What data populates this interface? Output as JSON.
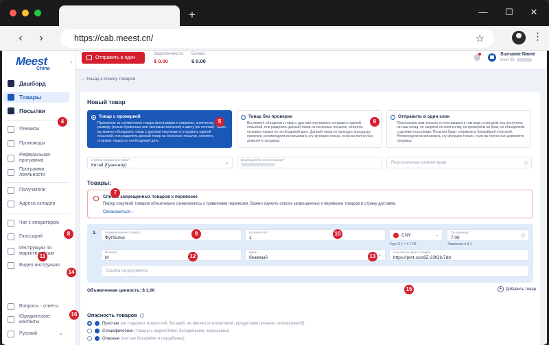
{
  "browser": {
    "url": "https://cab.meest.cn/",
    "new_tab_label": "+",
    "back_icon": "‹",
    "forward_icon": "›",
    "star_icon": "☆",
    "kebab_icon": "⋮",
    "minimize_icon": "—",
    "maximize_icon": "☐",
    "close_icon": "✕",
    "traffic_lights": [
      "#ff5f57",
      "#febc2e",
      "#28c840"
    ]
  },
  "brand": {
    "logo": "Meest",
    "sub": "China",
    "accent": "#1a57b7",
    "red": "#d6202f"
  },
  "sidebar": {
    "collapse_icon": "‹",
    "main": [
      {
        "label": "Дашборд",
        "icon": "dashboard-icon",
        "active": false
      },
      {
        "label": "Товары",
        "icon": "box-icon",
        "active": true
      },
      {
        "label": "Посылки",
        "icon": "parcel-icon",
        "active": false
      }
    ],
    "group1": [
      {
        "label": "Финансы",
        "icon": "finance-icon"
      },
      {
        "label": "Промокоды",
        "icon": "promo-icon"
      },
      {
        "label": "Реферальная программа",
        "icon": "referral-icon"
      },
      {
        "label": "Программа лояльности",
        "icon": "loyalty-icon"
      }
    ],
    "group2": [
      {
        "label": "Получатели",
        "icon": "recipients-icon"
      },
      {
        "label": "Адреса складов",
        "icon": "location-icon"
      }
    ],
    "group3": [
      {
        "label": "Чат с оператором",
        "icon": "chat-icon"
      },
      {
        "label": "Глоссарий",
        "icon": "glossary-icon"
      },
      {
        "label": "Инструкции по маркетплейсам",
        "icon": "instructions-icon"
      },
      {
        "label": "Видео инструкция",
        "icon": "video-icon"
      }
    ],
    "bottom": [
      {
        "label": "Вопросы - ответы",
        "icon": "faq-icon"
      },
      {
        "label": "Юридические контакты",
        "icon": "legal-icon"
      },
      {
        "label": "Русский",
        "icon": "globe-icon",
        "chevron": "⌄"
      }
    ]
  },
  "header": {
    "send_button": "Отправить в один клик",
    "debt_label": "Задолженность",
    "debt_value": "$ 0.00",
    "balance_label": "Баланс",
    "balance_value": "$ 0.00",
    "user_name": "Surname Name",
    "user_id_label": "User ID:"
  },
  "page": {
    "back_link": "← Назад к списку товаров",
    "title": "Новый товар",
    "options": [
      {
        "title": "Товар с проверкой",
        "desc": "Проверяем на соответствие товара фотографии и названию, количеству, размеру (только буквенные или числовые значения) и цвету (не оттенки). Также, вы можете объединять товар с другими покупками и отправить единой посылкой, или разделить данный товар на несколько посылок, оплатить отправку товара по необходимой дате.",
        "selected": true
      },
      {
        "title": "Товар без проверки",
        "desc": "Вы можете объединять товар с другими покупками и отправить единой посылкой, или разделить данный товар на несколько посылок, оплатить отправку товара по необходимой дате. Данный товар не проходит процедуру проверки, рекомендуем использовать эту функцию только, если вы полностью доверяете продавцу.",
        "selected": false
      },
      {
        "title": "Отправить в один клик",
        "desc": "Пересылаем вам посылку от поставщика в том виде, в котором она поступила на наш склад: не сверяем по количеству, не проверяем на брак, не объединяем с другими посылками. Посылка будет отправлена ближайшей отгрузкой. Рекомендуем использовать эту функцию только, если вы полностью доверяете продавцу.",
        "selected": false
      }
    ],
    "warehouse": {
      "caption": "Страна склада доставки*",
      "value": "Китай (Гуанчжоу)",
      "chevron": "⌄"
    },
    "tracking": {
      "caption": "Входящий № отслеживания*"
    },
    "comments": {
      "placeholder": "Персональные комментарии",
      "info_icon": "ⓘ"
    },
    "goods_title": "Товары:",
    "warning": {
      "title": "Список запрещенных товаров к перевозке",
      "text": "Перед покупкой товаров обязательно ознакомьтесь с правилами перевозки. Важно изучить список запрещенных к перевозке товаров в страну доставки.",
      "link": "Ознакомиться  ›"
    },
    "item": {
      "number": "1.",
      "name": {
        "caption": "Наименование товара*",
        "value": "Футболка"
      },
      "qty": {
        "caption": "Количество*",
        "value": "1"
      },
      "currency": {
        "value": "CNY",
        "note": "Курс $ 1 = ¥ 7.08",
        "chevron": "⌄"
      },
      "unit_price": {
        "caption": "За единицу*",
        "value": "7.08",
        "note": "Эквивалент $ 1",
        "info_icon": "ⓘ"
      },
      "size": {
        "caption": "Размер*",
        "value": "M"
      },
      "color": {
        "caption": "Цвет*",
        "value": "бежевый",
        "chevron": "⌄"
      },
      "photo": {
        "caption": "Ссылка на фото товара*",
        "value": "https://prnt.sc/s8Z-23lOIu7dd"
      },
      "docs": {
        "placeholder": "Ссылка на документы"
      }
    },
    "declared": "Объявленная ценность: $ 1.00",
    "add_item": "Добавить товар",
    "add_icon": "+",
    "danger_title": "Опасность товаров",
    "danger_options": [
      {
        "label": "Простые",
        "note": "(не содержат жидкостей, батарей, не являются косметикой, продуктами питания, электроникой)",
        "selected": true
      },
      {
        "label": "Специфические",
        "note": "(товары с жидкостями, батарейками, порошками)",
        "selected": false
      },
      {
        "label": "Опасные",
        "note": "(чистые батарейки и пауэрбанки)",
        "selected": false
      }
    ],
    "badges": [
      "4",
      "5",
      "6",
      "7",
      "8",
      "9",
      "10",
      "11",
      "12",
      "13",
      "14",
      "15",
      "16"
    ]
  }
}
